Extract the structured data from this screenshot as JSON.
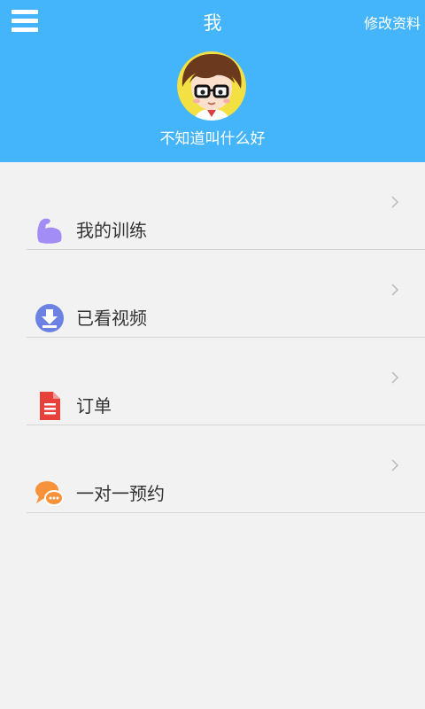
{
  "header": {
    "title": "我",
    "edit_label": "修改资料",
    "username": "不知道叫什么好",
    "background_color": "#45b5fb"
  },
  "menu": {
    "icon": "hamburger-menu-icon",
    "items": [
      {
        "label": "我的训练",
        "icon": "flexed-arm-icon",
        "color": "#a28cf5"
      },
      {
        "label": "已看视频",
        "icon": "download-circle-icon",
        "color": "#6b82e3"
      },
      {
        "label": "订单",
        "icon": "document-icon",
        "color": "#e8403b"
      },
      {
        "label": "一对一预约",
        "icon": "chat-bubble-icon",
        "color": "#f7923a"
      }
    ]
  }
}
